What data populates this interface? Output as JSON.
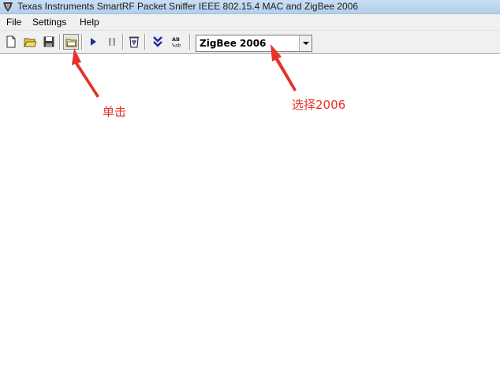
{
  "window": {
    "title": "Texas Instruments SmartRF Packet Sniffer IEEE 802.15.4 MAC and ZigBee 2006",
    "icon": "ti-app-icon"
  },
  "menu": {
    "items": [
      {
        "label": "File"
      },
      {
        "label": "Settings"
      },
      {
        "label": "Help"
      }
    ]
  },
  "toolbar": {
    "buttons": [
      {
        "icon": "new-document-icon"
      },
      {
        "icon": "open-folder-icon"
      },
      {
        "icon": "save-disk-icon"
      },
      {
        "icon": "clear-packets-icon",
        "pressed": true
      },
      {
        "icon": "play-icon"
      },
      {
        "icon": "pause-icon"
      },
      {
        "icon": "recycle-bin-icon"
      },
      {
        "icon": "scroll-down-icon"
      },
      {
        "icon": "ab-abbreviation-icon"
      }
    ],
    "protocol_select": {
      "value": "ZigBee 2006"
    }
  },
  "annotations": {
    "color": "#e5332a",
    "click_label": "单击",
    "select_label": "选择2006"
  }
}
